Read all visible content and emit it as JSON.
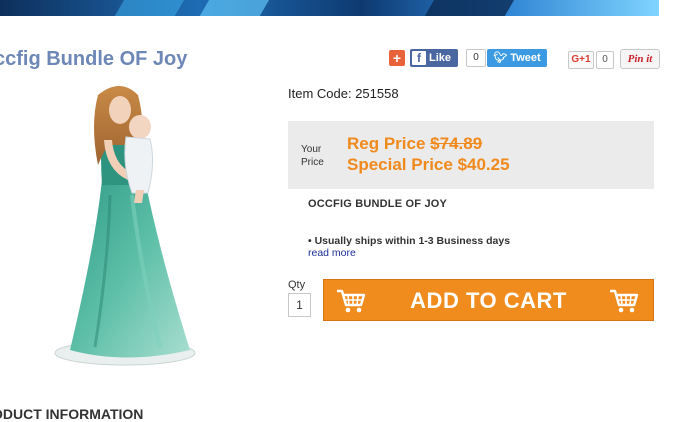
{
  "product": {
    "title": "ccfig Bundle OF Joy",
    "item_code_label": "Item Code: 251558",
    "description_title": "OCCFIG BUNDLE OF JOY",
    "ships_note": "• Usually ships within 1-3 Business days",
    "read_more": "read more",
    "image_icon": "figurine-image"
  },
  "social": {
    "plus": "+",
    "fb_label": "Like",
    "fb_letter": "f",
    "fb_count": "0",
    "tweet_label": "Tweet",
    "gplus_label": "G+1",
    "gplus_count": "0",
    "pin_label": "Pin it"
  },
  "price": {
    "your_price_line1": "Your",
    "your_price_line2": "Price",
    "reg_label": "Reg Price ",
    "reg_value": "$74.89",
    "special_label": "Special Price $40.25"
  },
  "cart": {
    "qty_label": "Qty",
    "qty_value": "1",
    "button_label": "ADD TO CART",
    "cart_icon": "cart-icon"
  },
  "sections": {
    "product_info": "ODUCT INFORMATION"
  },
  "colors": {
    "accent_orange": "#f08b1d",
    "title_blue": "#6d87b6",
    "facebook": "#4b67a1",
    "twitter": "#3b9ae1"
  }
}
